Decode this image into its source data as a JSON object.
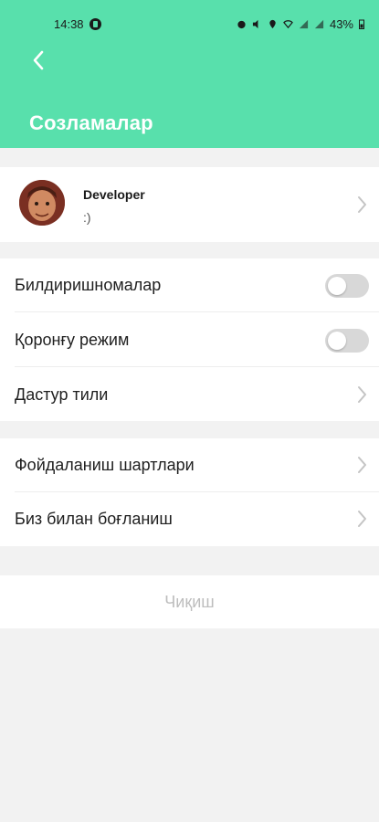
{
  "status_bar": {
    "time": "14:38",
    "battery": "43%"
  },
  "header": {
    "title": "Созламалар",
    "back_icon": "chevron-left-icon",
    "background_color": "#58e0ac"
  },
  "profile": {
    "name": "Developer",
    "status": ":)"
  },
  "settings": {
    "notifications_label": "Билдиришномалар",
    "notifications_on": false,
    "dark_mode_label": "Қоронғу режим",
    "dark_mode_on": false,
    "language_label": "Дастур тили"
  },
  "info": {
    "terms_label": "Фойдаланиш шартлари",
    "contact_label": "Биз билан боғланиш"
  },
  "logout": {
    "label": "Чиқиш"
  }
}
